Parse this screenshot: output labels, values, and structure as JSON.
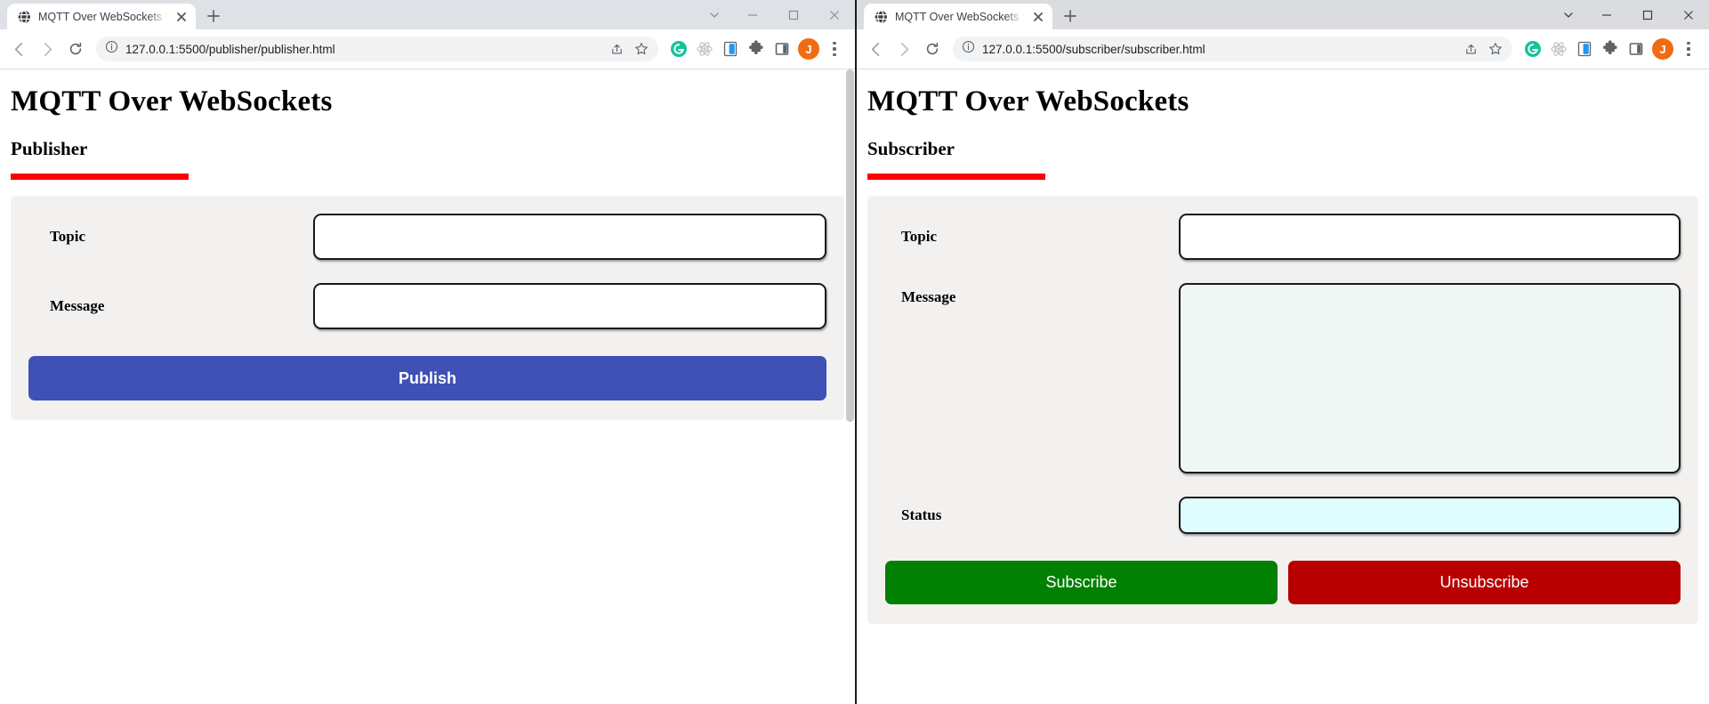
{
  "windows": [
    {
      "id": "publisher-window",
      "tab": {
        "title": "MQTT Over WebSockets Publisher",
        "favicon": "globe-icon",
        "close": "close-tab-icon",
        "newtab": "new-tab-icon"
      },
      "toolbar": {
        "back": "back-arrow-icon",
        "forward": "forward-arrow-icon",
        "reload": "reload-icon",
        "site_info": "info-circle-icon",
        "url": "127.0.0.1:5500/publisher/publisher.html",
        "share": "share-icon",
        "bookmark": "star-icon",
        "extensions": [
          {
            "name": "grammarly-icon",
            "glyph": "G",
            "color": "#15c39a"
          },
          {
            "name": "react-devtools-icon",
            "glyph": "",
            "color": "#bdbdbd"
          },
          {
            "name": "json-viewer-icon",
            "glyph": "",
            "color": "#2196f3"
          },
          {
            "name": "puzzle-extensions-icon",
            "glyph": "",
            "color": "#5f6368"
          },
          {
            "name": "side-panel-icon",
            "glyph": "",
            "color": "#5f6368"
          }
        ],
        "avatar_initial": "J",
        "menu": "three-dot-menu-icon"
      },
      "window_controls": {
        "tab_search": "chevron-down-icon",
        "minimize": "minimize-icon",
        "maximize": "maximize-icon",
        "close": "close-window-icon"
      },
      "page": {
        "title": "MQTT Over WebSockets",
        "subtitle": "Publisher",
        "accent_color": "#fb0000",
        "fields": [
          {
            "label": "Topic",
            "type": "input",
            "value": "",
            "placeholder": ""
          },
          {
            "label": "Message",
            "type": "input",
            "value": "",
            "placeholder": ""
          }
        ],
        "buttons": [
          {
            "label": "Publish",
            "color": "#3f51b5"
          }
        ]
      }
    },
    {
      "id": "subscriber-window",
      "tab": {
        "title": "MQTT Over WebSockets Subscriber",
        "favicon": "globe-icon",
        "close": "close-tab-icon",
        "newtab": "new-tab-icon"
      },
      "toolbar": {
        "back": "back-arrow-icon",
        "forward": "forward-arrow-icon",
        "reload": "reload-icon",
        "site_info": "info-circle-icon",
        "url": "127.0.0.1:5500/subscriber/subscriber.html",
        "share": "share-icon",
        "bookmark": "star-icon",
        "extensions": [
          {
            "name": "grammarly-icon",
            "glyph": "G",
            "color": "#15c39a"
          },
          {
            "name": "react-devtools-icon",
            "glyph": "",
            "color": "#bdbdbd"
          },
          {
            "name": "json-viewer-icon",
            "glyph": "",
            "color": "#2196f3"
          },
          {
            "name": "puzzle-extensions-icon",
            "glyph": "",
            "color": "#5f6368"
          },
          {
            "name": "side-panel-icon",
            "glyph": "",
            "color": "#5f6368"
          }
        ],
        "avatar_initial": "J",
        "menu": "three-dot-menu-icon"
      },
      "window_controls": {
        "tab_search": "chevron-down-icon",
        "minimize": "minimize-icon",
        "maximize": "maximize-icon",
        "close": "close-window-icon"
      },
      "page": {
        "title": "MQTT Over WebSockets",
        "subtitle": "Subscriber",
        "accent_color": "#fb0000",
        "fields": [
          {
            "label": "Topic",
            "type": "input",
            "value": "",
            "placeholder": ""
          },
          {
            "label": "Message",
            "type": "textarea",
            "value": "",
            "placeholder": ""
          },
          {
            "label": "Status",
            "type": "input",
            "value": "",
            "placeholder": ""
          }
        ],
        "buttons": [
          {
            "label": "Subscribe",
            "color": "#028002"
          },
          {
            "label": "Unsubscribe",
            "color": "#b80000"
          }
        ]
      }
    }
  ]
}
